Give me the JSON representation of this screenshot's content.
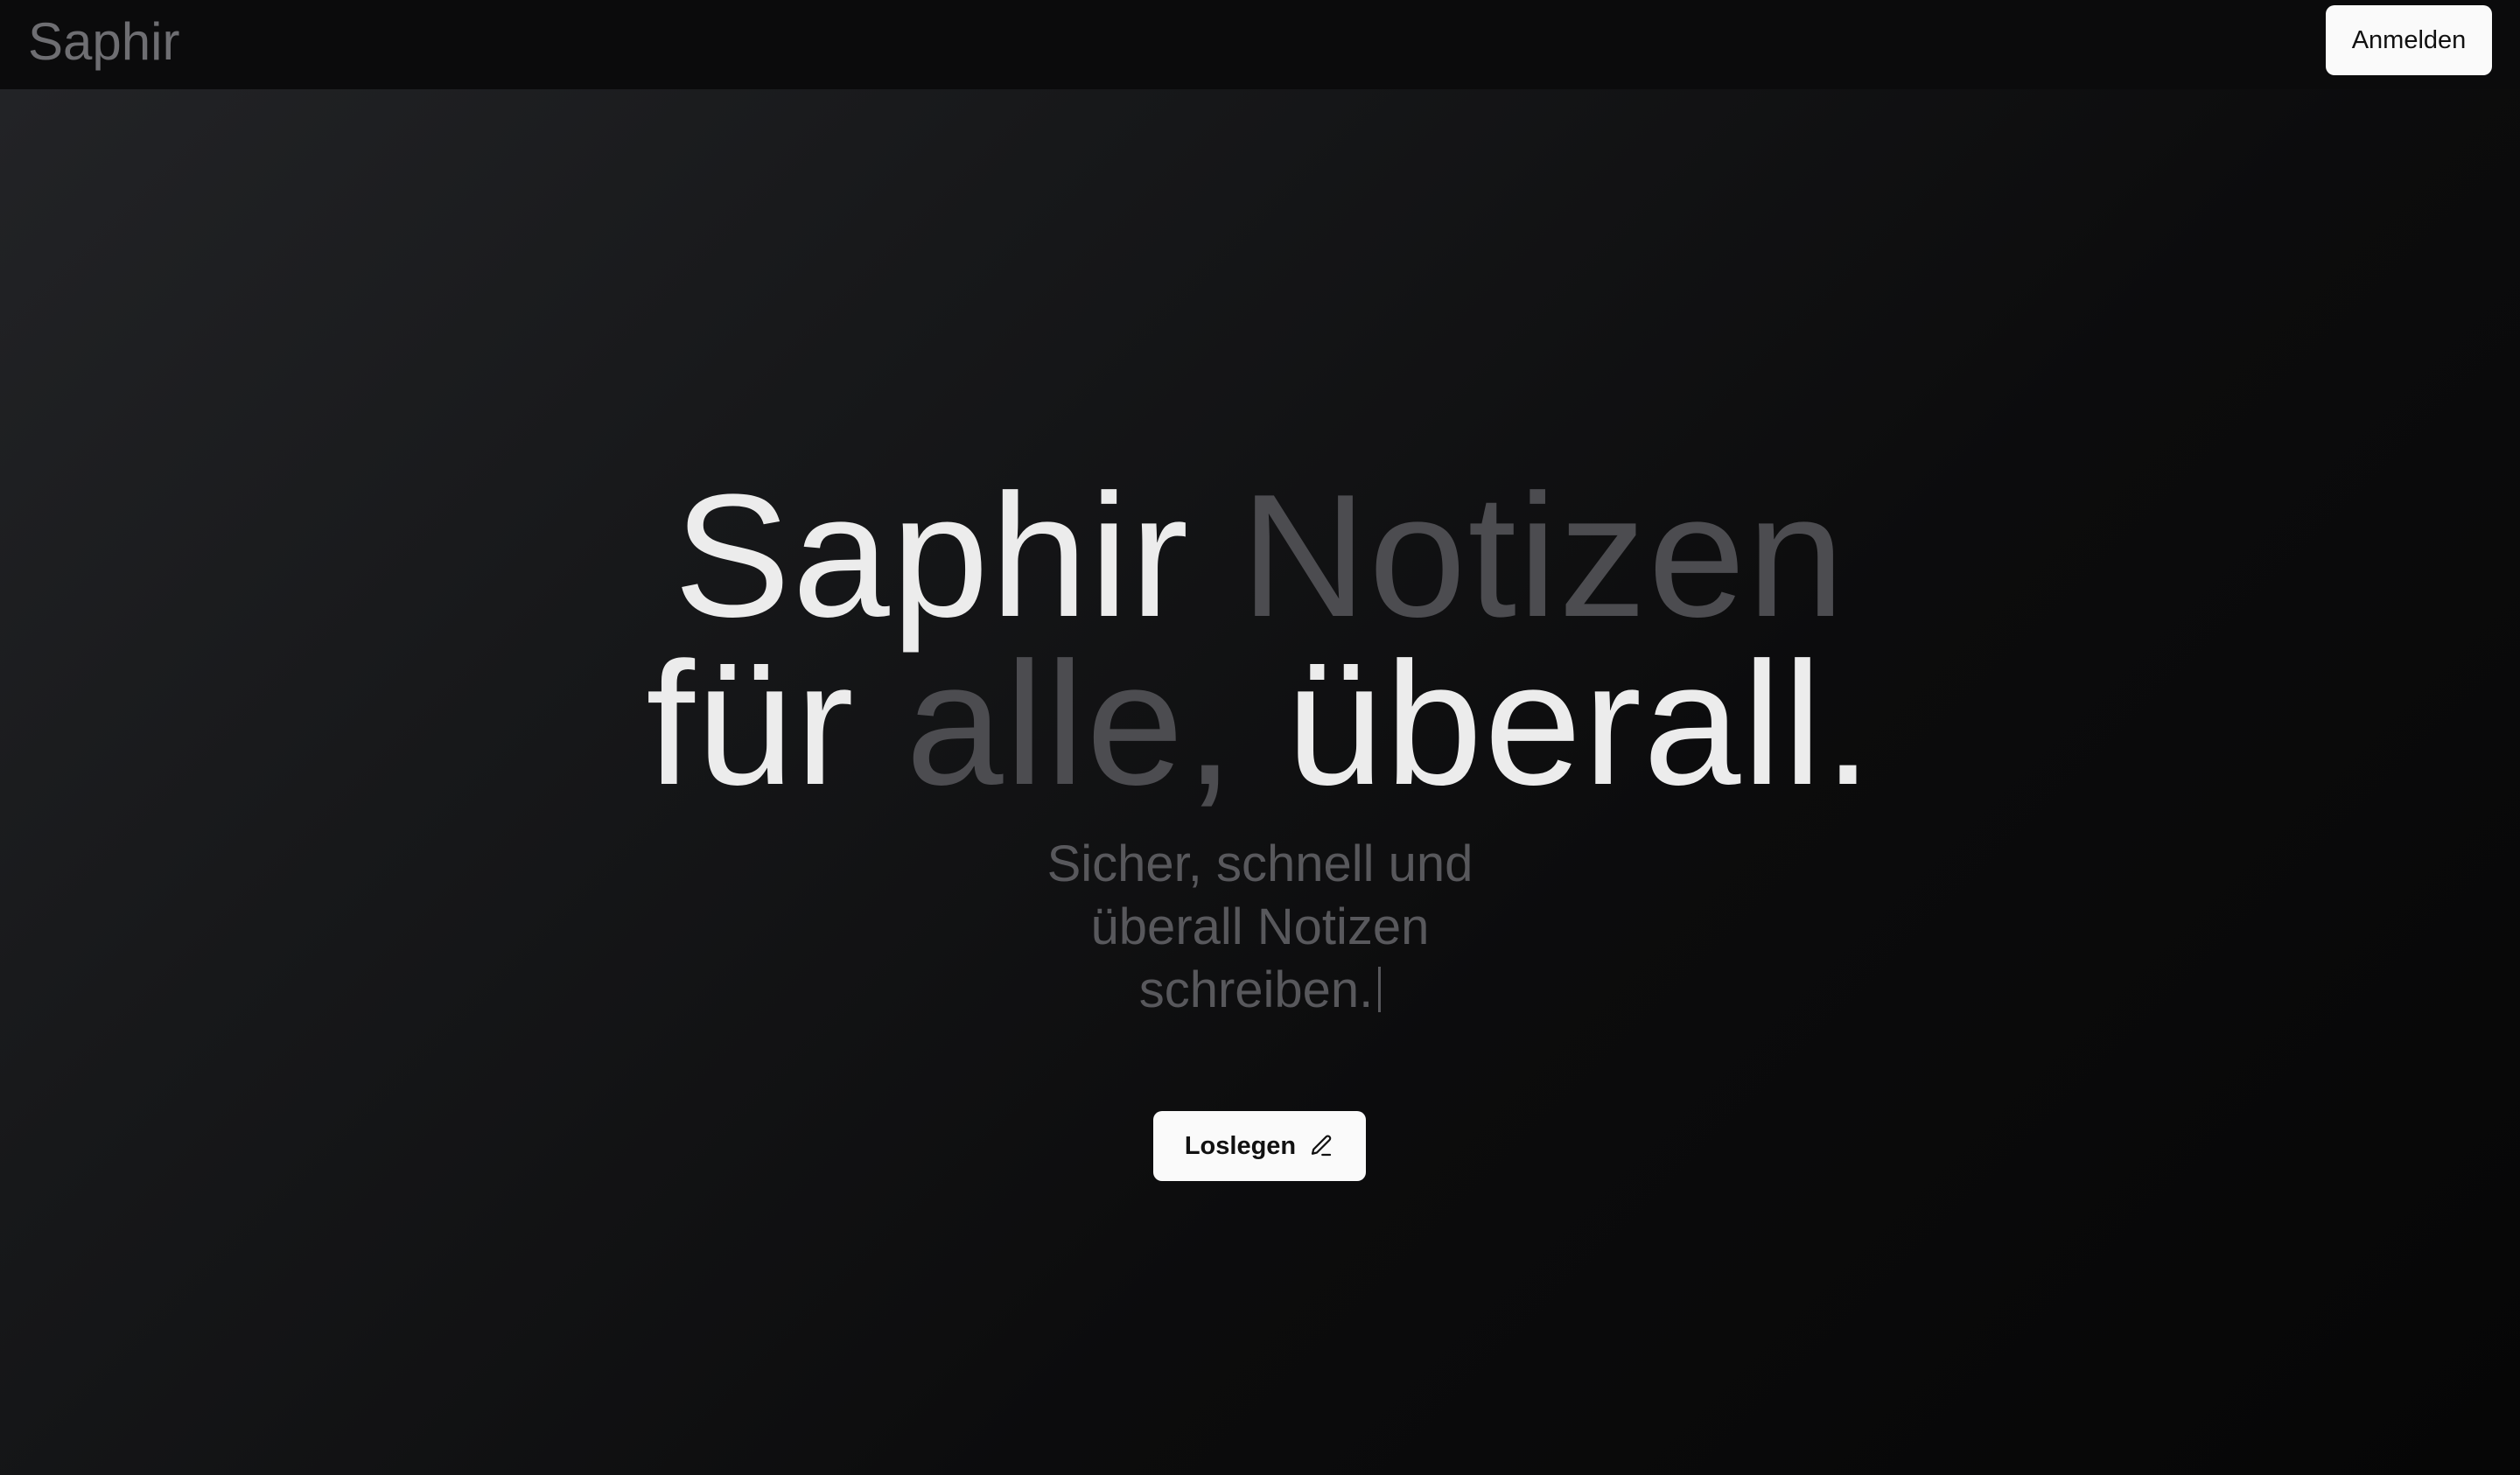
{
  "header": {
    "brand": "Saphir",
    "login_label": "Anmelden"
  },
  "hero": {
    "line1": {
      "word1": "Saphir",
      "word2": "Notizen"
    },
    "line2": {
      "word1": "für",
      "word2": "alle,",
      "word3": "überall."
    },
    "subtitle": "Sicher, schnell und überall Notizen schreiben.",
    "cta_label": "Loslegen",
    "cta_icon": "pencil-icon"
  },
  "colors": {
    "accent_light": "#ececec",
    "accent_dim": "#4c4c50",
    "button_bg": "#fafafa"
  }
}
